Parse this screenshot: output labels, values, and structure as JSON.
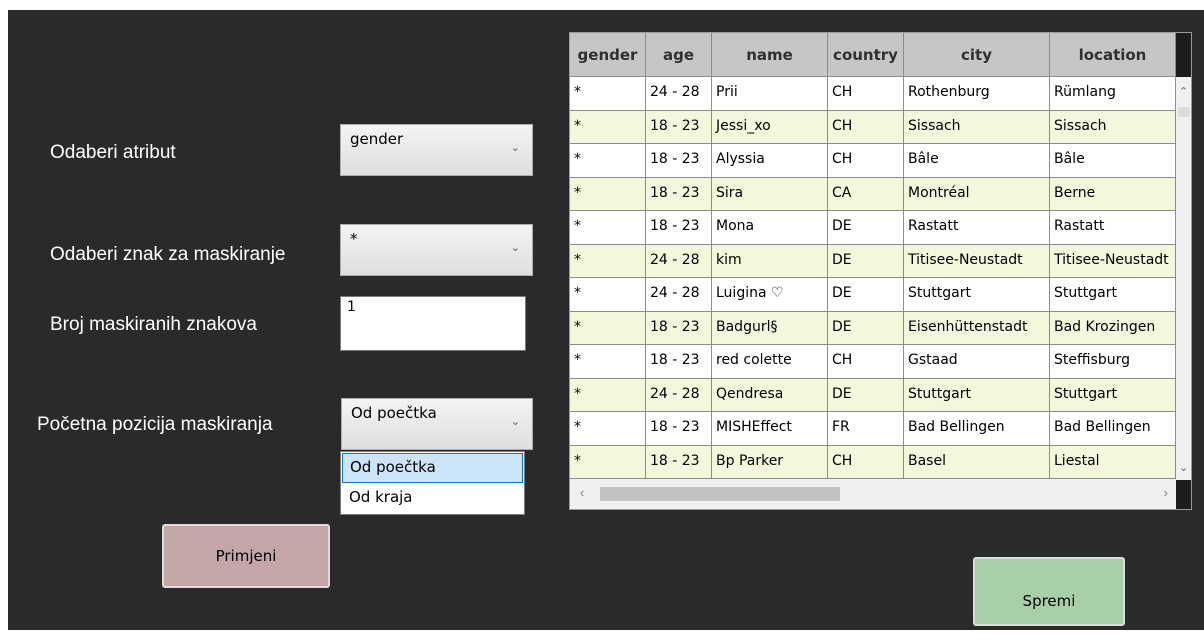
{
  "form": {
    "attr_label": "Odaberi atribut",
    "attr_value": "gender",
    "mask_char_label": "Odaberi znak za maskiranje",
    "mask_char_value": "*",
    "count_label": "Broj maskiranih znakova",
    "count_value": "1",
    "position_label": "Početna pozicija maskiranja",
    "position_value": "Od poečtka",
    "position_options": [
      "Od poečtka",
      "Od kraja"
    ],
    "apply_label": "Primjeni",
    "save_label": "Spremi"
  },
  "colors": {
    "background": "#2a2a2c",
    "apply_button": "#c4a6a6",
    "save_button": "#a8cfa8",
    "row_alt": "#f5f7dc",
    "header": "#c6c6c6",
    "selection": "#cce4f7"
  },
  "icons": {
    "chevron_down": "chevron-down-icon",
    "chevron_up": "chevron-up-icon",
    "chevron_left": "chevron-left-icon",
    "chevron_right": "chevron-right-icon"
  },
  "table": {
    "columns": [
      "gender",
      "age",
      "name",
      "country",
      "city",
      "location"
    ],
    "rows": [
      [
        "*",
        "24 - 28",
        "Prii",
        "CH",
        "Rothenburg",
        "Rümlang"
      ],
      [
        "*",
        "18 - 23",
        "Jessi_xo",
        "CH",
        "Sissach",
        "Sissach"
      ],
      [
        "*",
        "18 - 23",
        "Alyssia",
        "CH",
        "Bâle",
        "Bâle"
      ],
      [
        "*",
        "18 - 23",
        "Sira",
        "CA",
        "Montréal",
        "Berne"
      ],
      [
        "*",
        "18 - 23",
        "Mona",
        "DE",
        "Rastatt",
        "Rastatt"
      ],
      [
        "*",
        "24 - 28",
        "kim",
        "DE",
        "Titisee-Neustadt",
        "Titisee-Neustadt"
      ],
      [
        "*",
        "24 - 28",
        "Luigina ♡",
        "DE",
        "Stuttgart",
        "Stuttgart"
      ],
      [
        "*",
        "18 - 23",
        "Badgurl§",
        "DE",
        "Eisenhüttenstadt",
        "Bad Krozingen"
      ],
      [
        "*",
        "18 - 23",
        "red colette",
        "CH",
        "Gstaad",
        "Steffisburg"
      ],
      [
        "*",
        "24 - 28",
        "Qendresa",
        "DE",
        "Stuttgart",
        "Stuttgart"
      ],
      [
        "*",
        "18 - 23",
        "MISHEffect",
        "FR",
        "Bad Bellingen",
        "Bad Bellingen"
      ],
      [
        "*",
        "18 - 23",
        "Bp Parker",
        "CH",
        "Basel",
        "Liestal"
      ]
    ]
  }
}
